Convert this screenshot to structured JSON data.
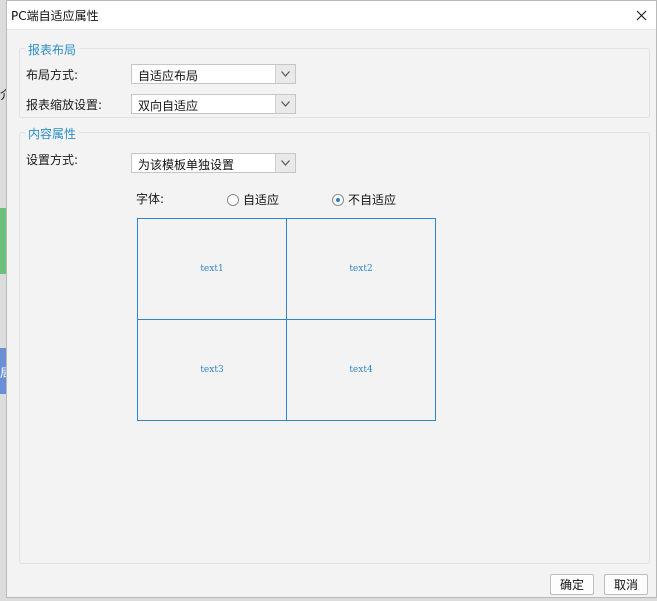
{
  "background": {
    "fragment_text_1": "介",
    "fragment_text_2": "局"
  },
  "dialog": {
    "title": "PC端自适应属性",
    "close_icon": "close-icon"
  },
  "report_layout": {
    "title": "报表布局",
    "layout_mode_label": "布局方式:",
    "layout_mode_value": "自适应布局",
    "zoom_setting_label": "报表缩放设置:",
    "zoom_setting_value": "双向自适应"
  },
  "content_properties": {
    "title": "内容属性",
    "setting_mode_label": "设置方式:",
    "setting_mode_value": "为该模板单独设置",
    "font_label": "字体:",
    "font_options": [
      {
        "label": "自适应",
        "checked": false
      },
      {
        "label": "不自适应",
        "checked": true
      }
    ],
    "preview_cells": [
      "text1",
      "text2",
      "text3",
      "text4"
    ]
  },
  "buttons": {
    "ok": "确定",
    "cancel": "取消"
  },
  "colors": {
    "accent": "#2a8ec9",
    "preview_border": "#2e86c8"
  }
}
